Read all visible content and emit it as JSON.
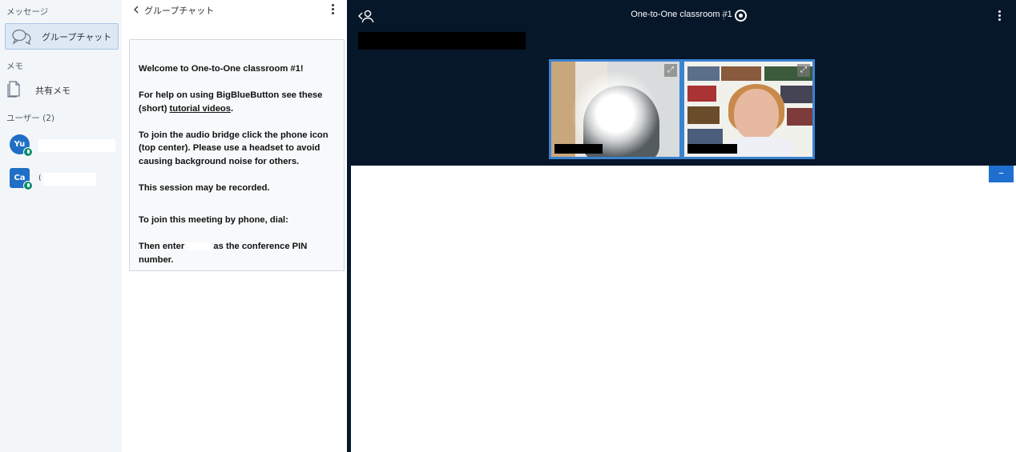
{
  "userlist": {
    "messages_label": "メッセージ",
    "public_chat_label": "グループチャット",
    "notes_label": "メモ",
    "shared_notes_label": "共有メモ",
    "users_label": "ユーザー (2)",
    "users": [
      {
        "initials": "Yu",
        "name": ""
      },
      {
        "initials": "Ca",
        "name": "("
      }
    ]
  },
  "chat": {
    "back_label": "グループチャット",
    "welcome_title": "Welcome to One-to-One classroom #1!",
    "help_prefix": "For help on using BigBlueButton see these (short)",
    "help_link": "tutorial videos",
    "help_suffix": ".",
    "audio_text": "To join the audio bridge click the phone icon (top center). Please use a headset to avoid causing background noise for others.",
    "recorded_text": "This session may be recorded.",
    "phone_text": "To join this meeting by phone, dial:",
    "pin_prefix": "Then enter",
    "pin_suffix": "as the conference PIN number."
  },
  "main": {
    "meeting_title": "One-to-One classroom #1",
    "minimize_label": "–",
    "expand_glyph": "⤢"
  },
  "colors": {
    "nav_bg": "#06172a",
    "accent": "#1f6fd1",
    "mic_badge": "#0a8e6e"
  }
}
